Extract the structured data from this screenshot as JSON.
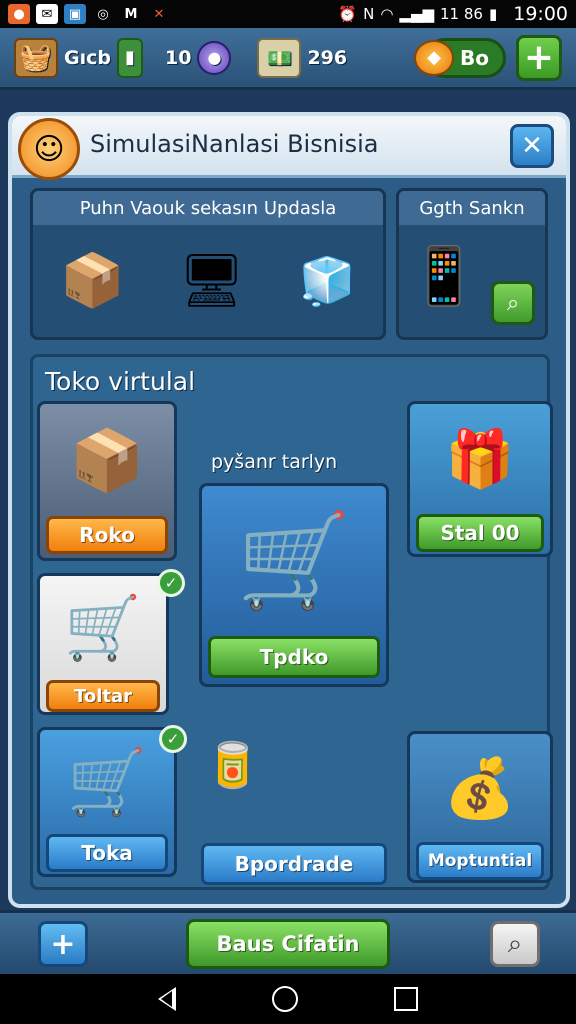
{
  "status_bar": {
    "left_icons": [
      "app-icon",
      "mail-icon",
      "image-icon",
      "target-icon",
      "m-icon",
      "x-icon"
    ],
    "right_text": "11 86",
    "time": "19:00"
  },
  "top_bar": {
    "basket_label": "Gıcb",
    "counter_value": "10",
    "money_value": "296",
    "coin_label": "Bo"
  },
  "panel": {
    "title": "SimulasiNanlasi Bisnisia"
  },
  "updates": {
    "header": "Puhn Vaouk sekasın Updasla"
  },
  "side": {
    "header": "Ggth Sankn"
  },
  "store": {
    "title": "Toko virtulal",
    "subtitle": "pyšanr tarlyn",
    "cards": [
      {
        "id": "roko",
        "label": "Roko"
      },
      {
        "id": "cart-center",
        "label": "Tpdko"
      },
      {
        "id": "stat",
        "label": "Stal 00"
      },
      {
        "id": "totar",
        "label": "Toltar"
      },
      {
        "id": "toka",
        "label": "Toka"
      },
      {
        "id": "upgrade",
        "label": "Bpordrade"
      },
      {
        "id": "mopturtial",
        "label": "Moptuntial"
      }
    ]
  },
  "bottom_bar": {
    "center_label": "Baus Cifatin"
  },
  "colors": {
    "panel_bg": "#2d5c86",
    "orange_button": "#f07f0d",
    "green_button": "#3f9a2a",
    "blue_button": "#2b7bc8"
  }
}
